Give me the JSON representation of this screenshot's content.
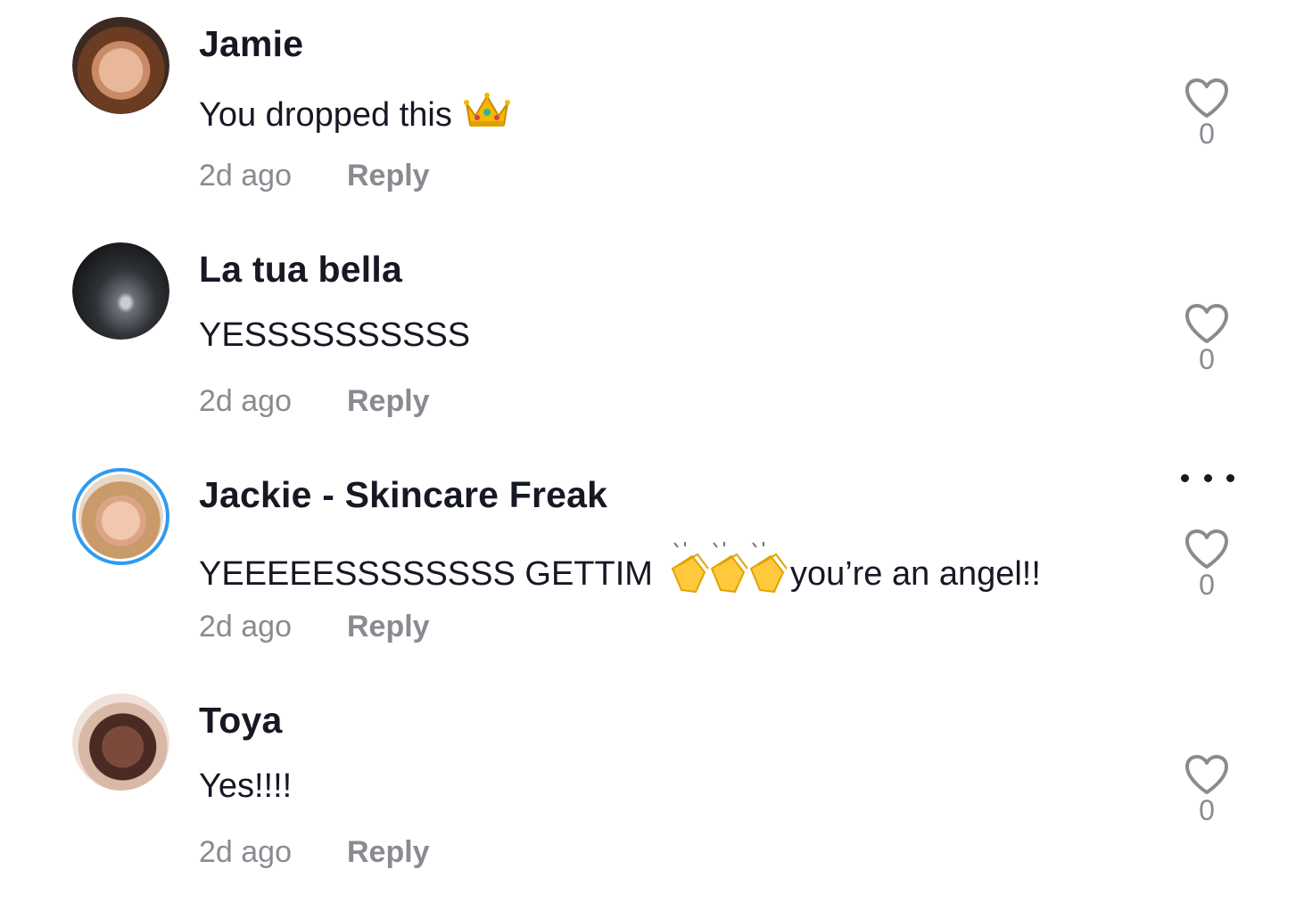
{
  "comments": [
    {
      "username": "Jamie",
      "text": "You dropped this",
      "emoji": "crown",
      "time": "2d ago",
      "reply_label": "Reply",
      "likes": "0"
    },
    {
      "username": "La tua bella",
      "text": "YESSSSSSSSSS",
      "time": "2d ago",
      "reply_label": "Reply",
      "likes": "0"
    },
    {
      "username": "Jackie - Skincare Freak",
      "text_before": "YEEEEESSSSSSSS GETTIM",
      "emoji": "clapping-hands x3",
      "text_after": "you’re an angel!!",
      "time": "2d ago",
      "reply_label": "Reply",
      "likes": "0"
    },
    {
      "username": "Toya",
      "text": "Yes!!!!",
      "time": "2d ago",
      "reply_label": "Reply",
      "likes": "0"
    }
  ],
  "colors": {
    "username": "#161823",
    "meta": "#8a8b91",
    "story_ring": "#2f9bf0"
  },
  "icons": {
    "like": "heart-outline-icon",
    "more": "more-horizontal-icon"
  }
}
